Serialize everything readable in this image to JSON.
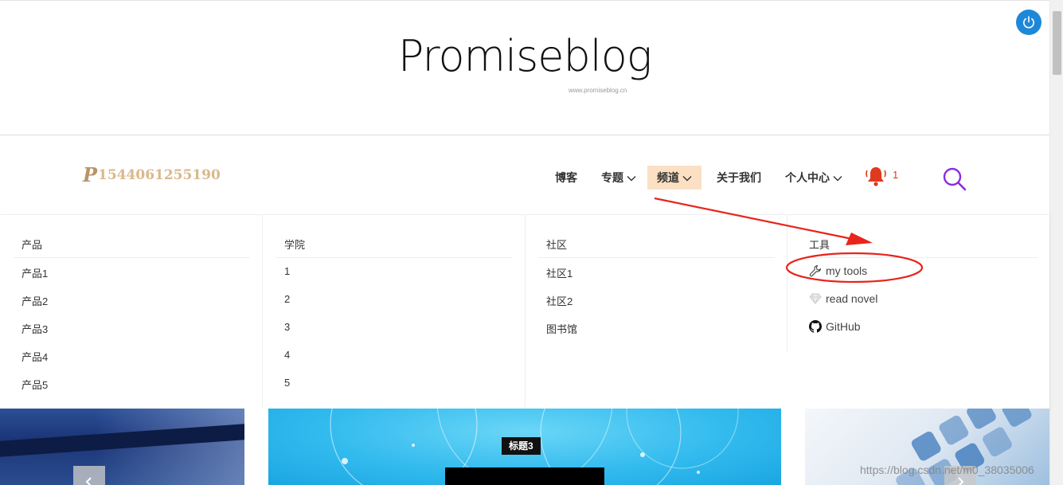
{
  "header": {
    "title": "Promiseblog",
    "subtitle": "www.promiseblog.cn",
    "power_icon": "power-icon"
  },
  "nav": {
    "logo_mark": "P",
    "logo_text": "1544061255190",
    "items": [
      {
        "label": "博客",
        "dropdown": false
      },
      {
        "label": "专题",
        "dropdown": true
      },
      {
        "label": "频道",
        "dropdown": true,
        "active": true
      },
      {
        "label": "关于我们",
        "dropdown": false
      },
      {
        "label": "个人中心",
        "dropdown": true
      }
    ],
    "notification_count": "1",
    "icons": [
      "bell-icon",
      "search-icon"
    ],
    "active_bg": "#fbe0c3"
  },
  "mega_menu": {
    "columns": [
      {
        "heading": "产品",
        "links": [
          "产品1",
          "产品2",
          "产品3",
          "产品4",
          "产品5"
        ]
      },
      {
        "heading": "学院",
        "links": [
          "1",
          "2",
          "3",
          "4",
          "5"
        ]
      },
      {
        "heading": "社区",
        "links": [
          "社区1",
          "社区2",
          "图书馆"
        ]
      },
      {
        "heading": "工具",
        "links": [
          {
            "label": "my tools",
            "icon": "wrench-icon"
          },
          {
            "label": "read novel",
            "icon": "diamond-icon"
          },
          {
            "label": "GitHub",
            "icon": "github-icon"
          }
        ]
      }
    ]
  },
  "carousel": {
    "slide_label": "标题3",
    "prev_icon": "chevron-left-icon",
    "next_icon": "chevron-right-icon"
  },
  "watermark": "https://blog.csdn.net/m0_38035006",
  "colors": {
    "accent_blue": "#1e88d8",
    "annotation_red": "#e8241b",
    "logo_gold": "#d9b88a",
    "bell_red": "#e03a1e",
    "search_purple": "#8a2be2"
  }
}
